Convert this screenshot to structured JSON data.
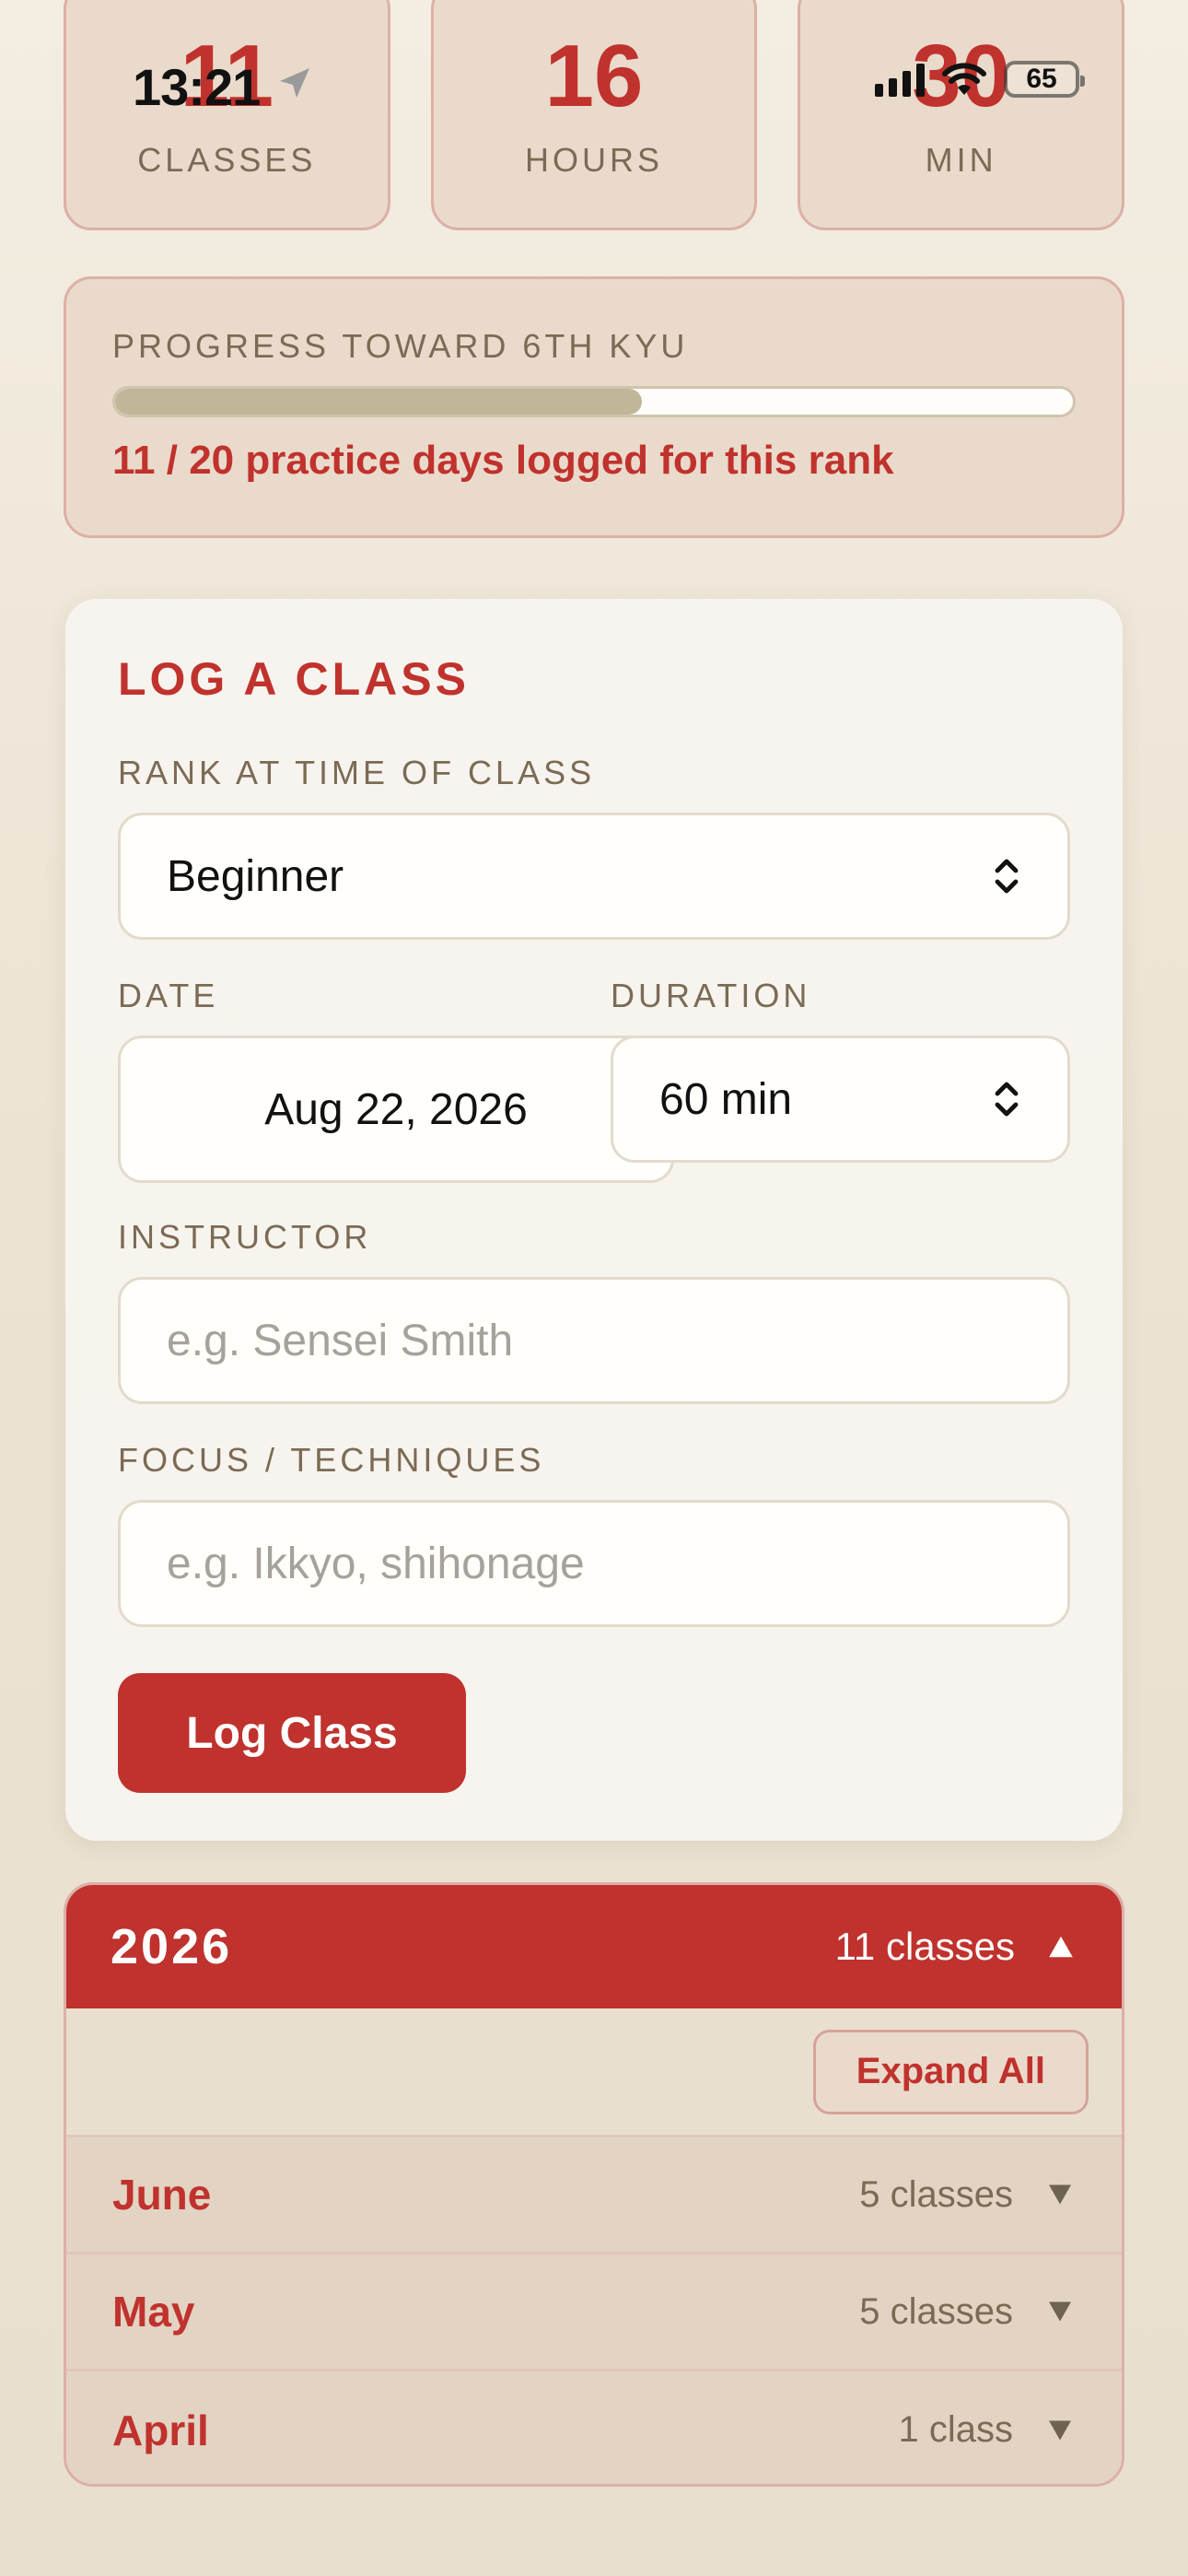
{
  "status_bar": {
    "time": "13:21",
    "battery": "65"
  },
  "stats": [
    {
      "value": "11",
      "label": "CLASSES"
    },
    {
      "value": "16",
      "label": "HOURS"
    },
    {
      "value": "30",
      "label": "MIN"
    }
  ],
  "progress": {
    "label": "PROGRESS TOWARD 6TH KYU",
    "fraction": 0.55,
    "text": "11 / 20 practice days logged for this rank"
  },
  "log_form": {
    "title": "LOG A CLASS",
    "rank_label": "RANK AT TIME OF CLASS",
    "rank_value": "Beginner",
    "date_label": "DATE",
    "date_value": "Aug 22, 2026",
    "duration_label": "DURATION",
    "duration_value": "60 min",
    "instructor_label": "INSTRUCTOR",
    "instructor_placeholder": "e.g. Sensei Smith",
    "focus_label": "FOCUS / TECHNIQUES",
    "focus_placeholder": "e.g. Ikkyo, shihonage",
    "submit_label": "Log Class"
  },
  "history": {
    "year": "2026",
    "year_count": "11 classes",
    "expand_all_label": "Expand All",
    "months": [
      {
        "name": "June",
        "count": "5 classes"
      },
      {
        "name": "May",
        "count": "5 classes"
      },
      {
        "name": "April",
        "count": "1 class"
      }
    ]
  },
  "colors": {
    "accent_red": "#c0322d",
    "muted_label": "#7b6b55",
    "tile_bg": "#eadacb",
    "tile_border": "#dcb0a6"
  }
}
